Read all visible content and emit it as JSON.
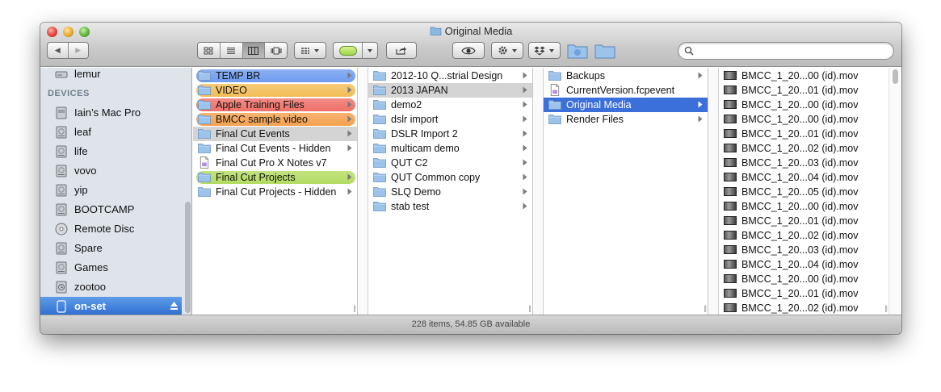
{
  "window": {
    "title": "Original Media",
    "status": "228 items, 54.85 GB available"
  },
  "toolbar": {
    "back_label": "◀",
    "forward_label": "▶"
  },
  "search": {
    "placeholder": "",
    "value": ""
  },
  "sidebar": {
    "top_item": {
      "label": "lemur",
      "icon": "network-disk-icon"
    },
    "devices_header": "DEVICES",
    "devices": [
      {
        "label": "Iain’s Mac Pro",
        "icon": "computer-icon"
      },
      {
        "label": "leaf",
        "icon": "hard-drive-icon"
      },
      {
        "label": "life",
        "icon": "hard-drive-icon"
      },
      {
        "label": "vovo",
        "icon": "hard-drive-icon"
      },
      {
        "label": "yip",
        "icon": "hard-drive-icon"
      },
      {
        "label": "BOOTCAMP",
        "icon": "hard-drive-icon"
      },
      {
        "label": "Remote Disc",
        "icon": "optical-disc-icon"
      },
      {
        "label": "Spare",
        "icon": "hard-drive-icon"
      },
      {
        "label": "Games",
        "icon": "hard-drive-icon"
      },
      {
        "label": "zootoo",
        "icon": "time-machine-drive-icon"
      },
      {
        "label": "on-set",
        "icon": "external-drive-icon",
        "selected": true
      }
    ]
  },
  "columns": {
    "col1": [
      {
        "label": "TEMP BR",
        "tag": "#6f9cf0"
      },
      {
        "label": "VIDEO",
        "tag": "#f2bd57"
      },
      {
        "label": "Apple Training Files",
        "tag": "#ef7068"
      },
      {
        "label": "BMCC sample video",
        "tag": "#f4a14e"
      },
      {
        "label": "Final Cut Events",
        "state": "path"
      },
      {
        "label": "Final Cut Events - Hidden"
      },
      {
        "label": "Final Cut Pro X Notes v7",
        "kind": "document"
      },
      {
        "label": "Final Cut Projects",
        "tag": "#b3dc61"
      },
      {
        "label": "Final Cut Projects - Hidden"
      }
    ],
    "col2": [
      {
        "label": "2012-10 Q...strial Design"
      },
      {
        "label": "2013 JAPAN",
        "state": "path"
      },
      {
        "label": "demo2"
      },
      {
        "label": "dslr import"
      },
      {
        "label": "DSLR Import 2"
      },
      {
        "label": "multicam demo"
      },
      {
        "label": "QUT C2"
      },
      {
        "label": "QUT Common copy"
      },
      {
        "label": "SLQ Demo"
      },
      {
        "label": "stab test"
      }
    ],
    "col3": [
      {
        "label": "Backups"
      },
      {
        "label": "CurrentVersion.fcpevent",
        "kind": "document"
      },
      {
        "label": "Original Media",
        "state": "selected"
      },
      {
        "label": "Render Files"
      }
    ],
    "col4": [
      "BMCC_1_20...00 (id).mov",
      "BMCC_1_20...01 (id).mov",
      "BMCC_1_20...00 (id).mov",
      "BMCC_1_20...00 (id).mov",
      "BMCC_1_20...01 (id).mov",
      "BMCC_1_20...02 (id).mov",
      "BMCC_1_20...03 (id).mov",
      "BMCC_1_20...04 (id).mov",
      "BMCC_1_20...05 (id).mov",
      "BMCC_1_20...00 (id).mov",
      "BMCC_1_20...01 (id).mov",
      "BMCC_1_20...02 (id).mov",
      "BMCC_1_20...03 (id).mov",
      "BMCC_1_20...04 (id).mov",
      "BMCC_1_20...00 (id).mov",
      "BMCC_1_20...01 (id).mov",
      "BMCC_1_20...02 (id).mov"
    ]
  },
  "colors": {
    "selection_blue": "#3b6fd9",
    "path_gray": "#d4d4d4",
    "sidebar_bg": "#dee4ea",
    "folder_blue": "#9cc3ea"
  }
}
